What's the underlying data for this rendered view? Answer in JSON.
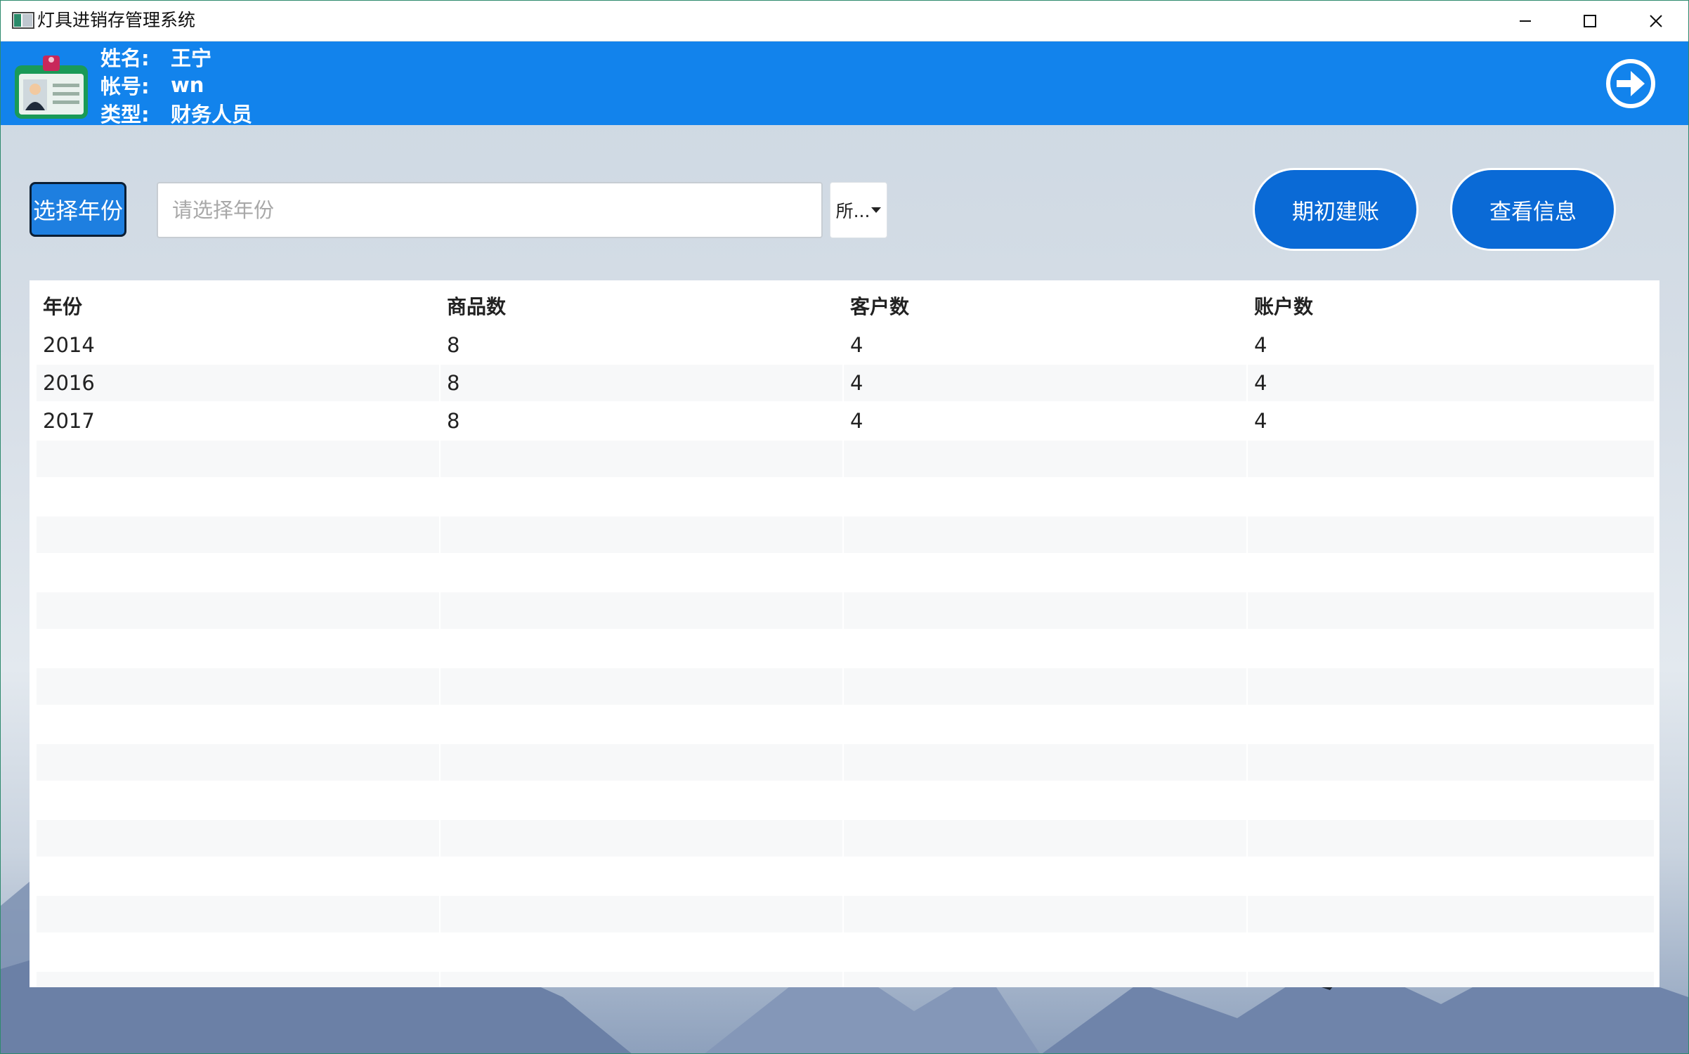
{
  "window": {
    "title": "灯具进销存管理系统"
  },
  "user": {
    "name_label": "姓名:",
    "name_value": "王宁",
    "account_label": "帐号:",
    "account_value": "wn",
    "type_label": "类型:",
    "type_value": "财务人员"
  },
  "toolbar": {
    "choose_year_label": "选择年份",
    "year_input_placeholder": "请选择年份",
    "year_input_value": "",
    "dropdown_label": "所...",
    "opening_button_label": "期初建账",
    "view_button_label": "查看信息"
  },
  "table": {
    "columns": [
      "年份",
      "商品数",
      "客户数",
      "账户数"
    ],
    "rows": [
      [
        "2014",
        "8",
        "4",
        "4"
      ],
      [
        "2016",
        "8",
        "4",
        "4"
      ],
      [
        "2017",
        "8",
        "4",
        "4"
      ]
    ]
  },
  "colors": {
    "header_blue": "#1283ec",
    "button_blue": "#0a6ad6",
    "choose_year_blue": "#1e7fe0"
  },
  "icons": {
    "app": "app-window-icon",
    "badge": "id-badge-icon",
    "logout": "arrow-right-circle-icon"
  }
}
